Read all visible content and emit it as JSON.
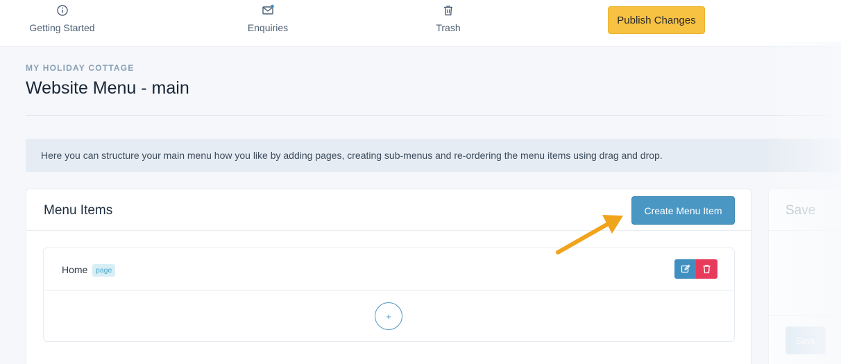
{
  "nav": {
    "items": [
      {
        "label": "Getting Started",
        "icon": "info-circle-icon"
      },
      {
        "label": "Enquiries",
        "icon": "mail-icon"
      },
      {
        "label": "Trash",
        "icon": "trash-icon"
      }
    ],
    "publish_label": "Publish Changes"
  },
  "header": {
    "eyebrow": "MY HOLIDAY COTTAGE",
    "title": "Website Menu - main"
  },
  "info_text": "Here you can structure your main menu how you like by adding pages, creating sub-menus and re-ordering the menu items using drag and drop.",
  "menu_card": {
    "title": "Menu Items",
    "create_label": "Create Menu Item",
    "items": [
      {
        "label": "Home",
        "badge": "page"
      }
    ],
    "add_symbol": "+"
  },
  "side_panel": {
    "title": "Save",
    "button_label": "Save"
  },
  "colors": {
    "accent": "#4a97c4",
    "publish": "#f7c142",
    "delete": "#e83b5c",
    "arrow": "#f0a41c"
  }
}
